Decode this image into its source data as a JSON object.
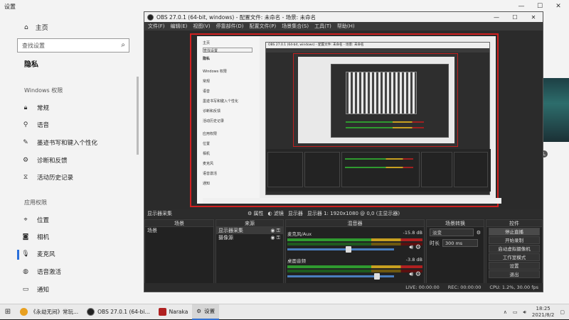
{
  "settings": {
    "title": "设置",
    "home": "主页",
    "search_placeholder": "查找设置",
    "page_title": "隐私",
    "section_windows": "Windows 权限",
    "section_apps": "应用权限",
    "nav_items": [
      {
        "label": "常规",
        "icon": "lock-icon"
      },
      {
        "label": "语音",
        "icon": "speech-icon"
      },
      {
        "label": "墨迹书写和键入个性化",
        "icon": "pen-icon"
      },
      {
        "label": "诊断和反馈",
        "icon": "diagnostics-icon"
      },
      {
        "label": "活动历史记录",
        "icon": "history-icon"
      }
    ],
    "app_items": [
      {
        "label": "位置",
        "icon": "location-icon"
      },
      {
        "label": "相机",
        "icon": "camera-icon"
      },
      {
        "label": "麦克风",
        "icon": "microphone-icon"
      },
      {
        "label": "语音激活",
        "icon": "voice-activation-icon"
      },
      {
        "label": "通知",
        "icon": "notification-icon"
      }
    ],
    "avatar_letter": "L"
  },
  "obs": {
    "title": "OBS 27.0.1 (64-bit, windows) - 配置文件: 未命名 - 场景: 未命名",
    "menu": [
      "文件(F)",
      "编辑(E)",
      "视图(V)",
      "停靠部件(D)",
      "配置文件(P)",
      "场景集合(S)",
      "工具(T)",
      "帮助(H)"
    ],
    "context_bar": {
      "source": "显示器采集",
      "properties": "属性",
      "filters": "滤镜",
      "display_label": "显示器",
      "display_value": "显示器 1: 1920x1080 @ 0,0 (主显示器)"
    },
    "scenes": {
      "title": "场景",
      "items": [
        "场景"
      ]
    },
    "sources": {
      "title": "来源",
      "items": [
        "显示器采集",
        "摄像源"
      ]
    },
    "mixer": {
      "title": "混音器",
      "channels": [
        {
          "name": "麦克风/Aux",
          "db": "-15.8 dB",
          "level": 0.58
        },
        {
          "name": "桌面音频",
          "db": "-3.8 dB",
          "level": 0.85
        }
      ]
    },
    "transitions": {
      "title": "场景转换",
      "type": "淡变",
      "duration_label": "时长",
      "duration": "300 ms"
    },
    "controls": {
      "title": "控件",
      "buttons": [
        "停止直播",
        "开始录制",
        "启动虚拟摄像机",
        "工作室模式",
        "设置",
        "退出"
      ]
    },
    "status": {
      "live": "LIVE: 00:00:00",
      "rec": "REC: 00:00:00",
      "cpu": "CPU: 1.2%, 30.00 fps"
    },
    "nested": {
      "side_items": [
        "主页",
        "查找设置",
        "隐私",
        "Windows 权限",
        "常规",
        "语音",
        "墨迹书写和键入个性化",
        "诊断和反馈",
        "活动历史记录",
        "应用权限",
        "位置",
        "相机",
        "麦克风",
        "语音激活",
        "通知"
      ]
    }
  },
  "taskbar": {
    "items": [
      {
        "label": "《永劫无间》常玩...",
        "icon": "chrome-icon",
        "color": "#e8a020"
      },
      {
        "label": "OBS 27.0.1 (64-bi...",
        "icon": "obs-icon",
        "color": "#222222"
      },
      {
        "label": "Naraka",
        "icon": "naraka-icon",
        "color": "#b02020"
      },
      {
        "label": "设置",
        "icon": "gear-icon",
        "color": "#555555"
      }
    ],
    "time": "18:25",
    "date": "2021/8/2"
  }
}
